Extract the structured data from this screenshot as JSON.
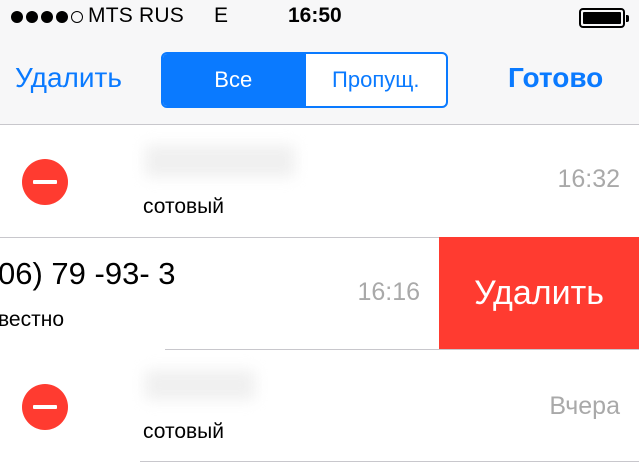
{
  "status_bar": {
    "signal_dots": [
      true,
      true,
      true,
      true,
      false
    ],
    "carrier": "MTS RUS",
    "network": "E",
    "time": "16:50",
    "battery_level": 1.0
  },
  "nav": {
    "left_button": "Удалить",
    "right_button": "Готово",
    "segments": [
      {
        "label": "Все",
        "selected": true
      },
      {
        "label": "Пропущ.",
        "selected": false
      }
    ]
  },
  "calls": [
    {
      "name": "",
      "type": "сотовый",
      "time": "16:32"
    },
    {
      "number": "06) 79   -93-  3",
      "type": "вестно",
      "time": "16:16",
      "swipe_action": "Удалить"
    },
    {
      "name": "",
      "type": "сотовый",
      "time": "Вчера"
    }
  ],
  "colors": {
    "accent": "#0a7aff",
    "destructive": "#ff3b30",
    "secondary_text": "#a9a9a9",
    "separator": "#c8c7cc"
  },
  "icons": {
    "delete_control": "minus-circle-icon",
    "battery": "battery-icon",
    "signal": "signal-dots-icon"
  }
}
